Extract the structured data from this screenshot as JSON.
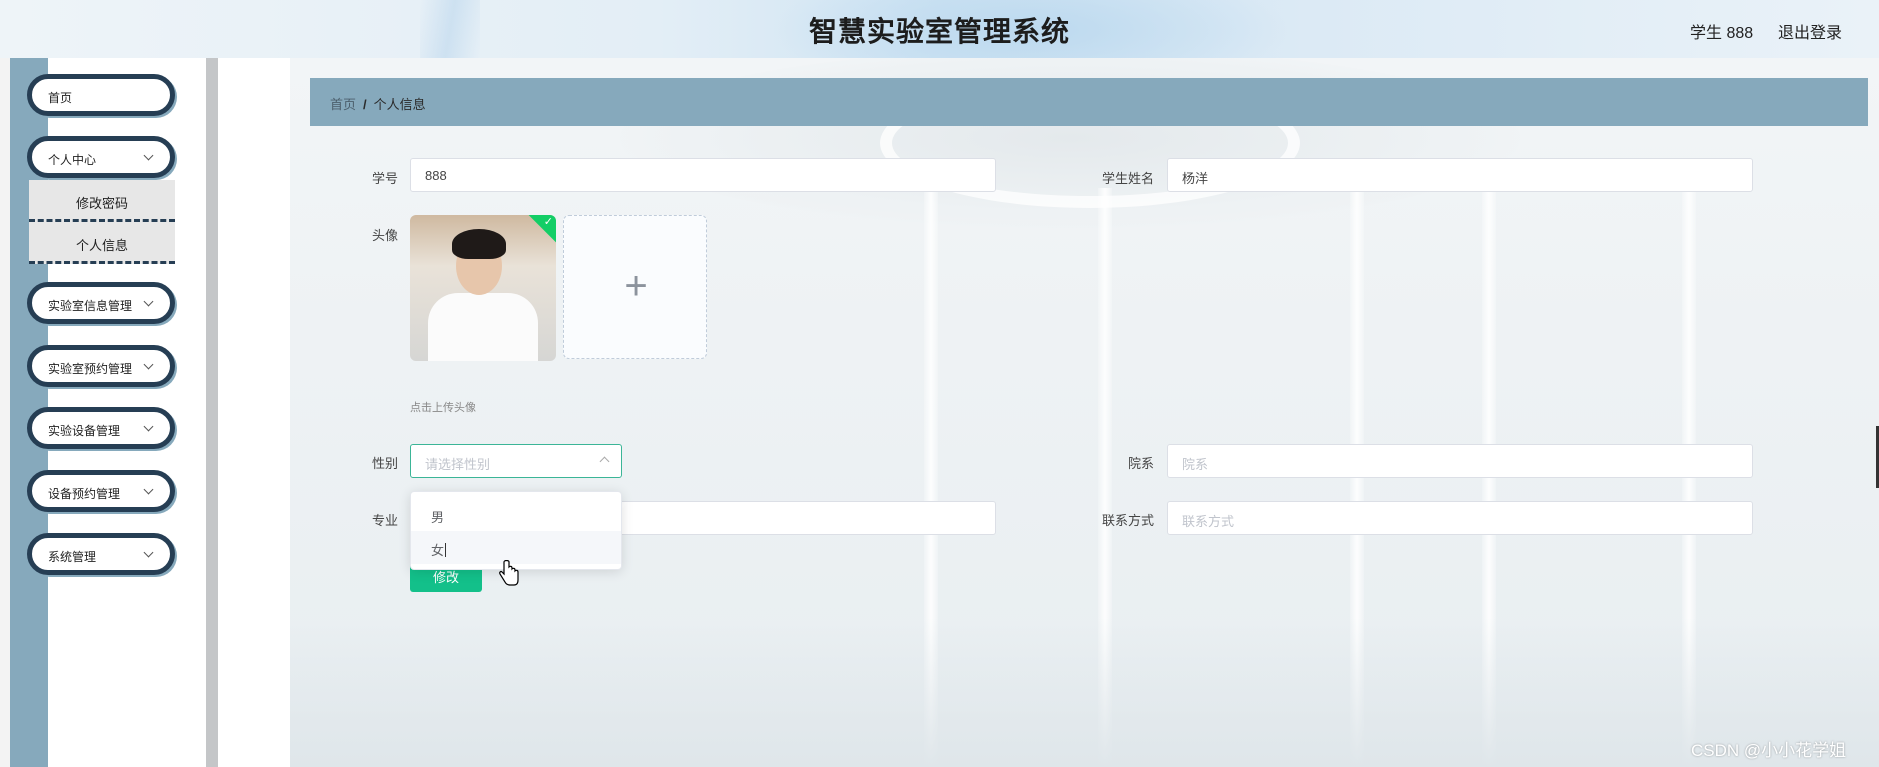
{
  "header": {
    "title": "智慧实验室管理系统",
    "user": "学生 888",
    "logout": "退出登录"
  },
  "sidebar": {
    "items": [
      {
        "label": "首页",
        "has_children": false
      },
      {
        "label": "个人中心",
        "has_children": true,
        "expanded": true,
        "children": [
          {
            "label": "修改密码"
          },
          {
            "label": "个人信息"
          }
        ]
      },
      {
        "label": "实验室信息管理",
        "has_children": true
      },
      {
        "label": "实验室预约管理",
        "has_children": true
      },
      {
        "label": "实验设备管理",
        "has_children": true
      },
      {
        "label": "设备预约管理",
        "has_children": true
      },
      {
        "label": "系统管理",
        "has_children": true
      }
    ]
  },
  "breadcrumb": {
    "home": "首页",
    "separator": "/",
    "current": "个人信息"
  },
  "form": {
    "student_id": {
      "label": "学号",
      "value": "888"
    },
    "student_name": {
      "label": "学生姓名",
      "value": "杨洋"
    },
    "avatar": {
      "label": "头像",
      "hint": "点击上传头像",
      "upload_icon": "plus-icon"
    },
    "gender": {
      "label": "性别",
      "placeholder": "请选择性别",
      "options": [
        "男",
        "女"
      ],
      "hovered_option": "女"
    },
    "department": {
      "label": "院系",
      "placeholder": "院系"
    },
    "major": {
      "label": "专业",
      "value": ""
    },
    "contact": {
      "label": "联系方式",
      "placeholder": "联系方式"
    },
    "submit_label": "修改"
  },
  "watermark": "CSDN @小小花学姐",
  "colors": {
    "sidebar_strip": "#86a9bc",
    "nav_border": "#263e54",
    "breadcrumb_bg": "#86a9bc",
    "accent": "#13c08a"
  }
}
